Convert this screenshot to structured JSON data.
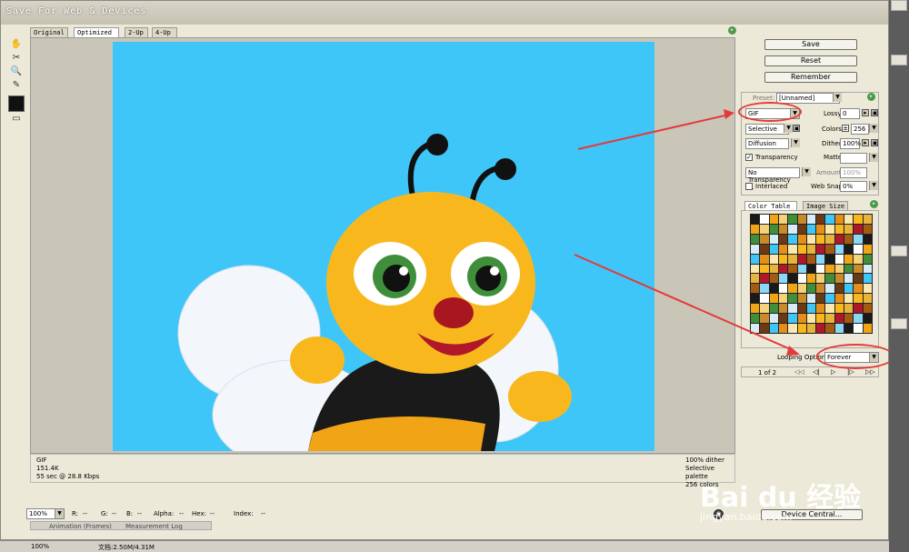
{
  "window": {
    "title": "Save For Web & Devices"
  },
  "view_tabs": [
    "Original",
    "Optimized",
    "2-Up",
    "4-Up"
  ],
  "buttons": {
    "save": "Save",
    "reset": "Reset",
    "remember": "Remember",
    "device_central": "Device Central..."
  },
  "settings": {
    "preset_label": "Preset:",
    "preset_value": "[Unnamed]",
    "format": "GIF",
    "lossy_label": "Lossy:",
    "lossy_value": "0",
    "reduction": "Selective",
    "colors_label": "Colors:",
    "colors_value": "256",
    "dither_algo": "Diffusion",
    "dither_label": "Dither:",
    "dither_value": "100%",
    "transparency_label": "Transparency",
    "matte_label": "Matte:",
    "transparency_dither": "No Transparency ...",
    "amount_label": "Amount:",
    "amount_value": "100%",
    "interlaced_label": "Interlaced",
    "websnap_label": "Web Snap:",
    "websnap_value": "0%"
  },
  "panel_tabs": {
    "color_table": "Color Table",
    "image_size": "Image Size"
  },
  "looping": {
    "label": "Looping Options:",
    "value": "Forever"
  },
  "animation": {
    "frame_counter": "1 of 2"
  },
  "info_left": [
    "GIF",
    "151.4K",
    "55 sec @ 28.8 Kbps"
  ],
  "info_right": [
    "100% dither",
    "Selective palette",
    "256 colors"
  ],
  "bottom": {
    "zoom": "100%",
    "r": "R:",
    "r_val": "--",
    "g": "G:",
    "g_val": "--",
    "b": "B:",
    "b_val": "--",
    "alpha": "Alpha:",
    "alpha_val": "--",
    "hex": "Hex:",
    "hex_val": "--",
    "index": "Index:",
    "index_val": "--"
  },
  "status": {
    "zoom": "100%",
    "doc": "文档:2.50M/4.31M",
    "tab1": "Animation (Frames)",
    "tab2": "Measurement Log"
  },
  "watermark": {
    "brand": "Bai du 经验",
    "url": "jingyan.baidu.com"
  },
  "colors": {
    "sky": "#3fc6f9",
    "accent": "#4c9a4c",
    "annot": "#e43a3a"
  }
}
